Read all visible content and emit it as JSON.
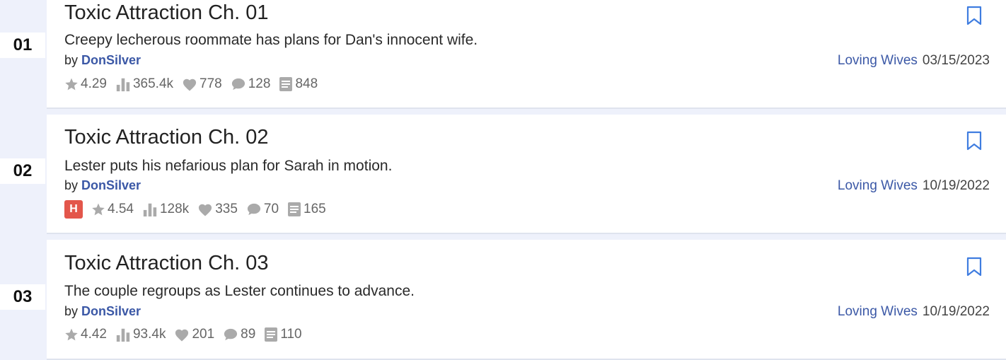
{
  "colors": {
    "accent": "#3b58a6",
    "hot_badge": "#e3564b",
    "bookmark": "#3f7de0",
    "stat_icon": "#aaaaaa"
  },
  "stories": [
    {
      "rank": "01",
      "title": "Toxic Attraction Ch. 01",
      "description": "Creepy lecherous roommate has plans for Dan's innocent wife.",
      "by_label": "by",
      "author": "DonSilver",
      "category": "Loving Wives",
      "date": "03/15/2023",
      "rating": "4.29",
      "views": "365.4k",
      "favorites": "778",
      "comments": "128",
      "words": "848"
    },
    {
      "rank": "02",
      "title": "Toxic Attraction Ch. 02",
      "description": "Lester puts his nefarious plan for Sarah in motion.",
      "by_label": "by",
      "author": "DonSilver",
      "category": "Loving Wives",
      "date": "10/19/2022",
      "hot_badge": "H",
      "rating": "4.54",
      "views": "128k",
      "favorites": "335",
      "comments": "70",
      "words": "165"
    },
    {
      "rank": "03",
      "title": "Toxic Attraction Ch. 03",
      "description": "The couple regroups as Lester continues to advance.",
      "by_label": "by",
      "author": "DonSilver",
      "category": "Loving Wives",
      "date": "10/19/2022",
      "rating": "4.42",
      "views": "93.4k",
      "favorites": "201",
      "comments": "89",
      "words": "110"
    }
  ]
}
